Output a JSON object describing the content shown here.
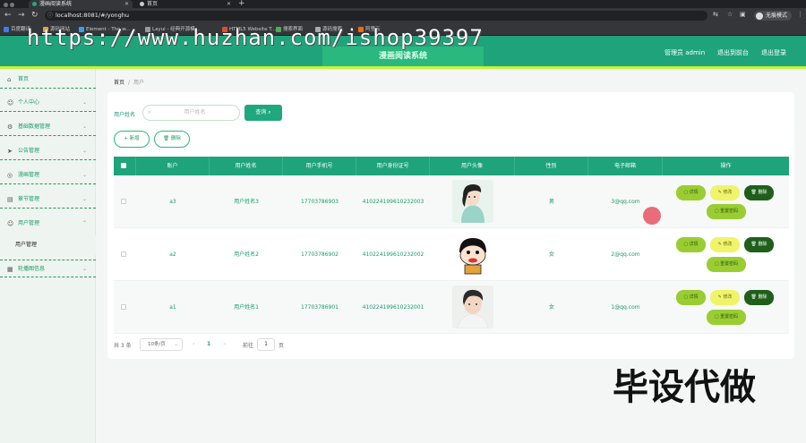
{
  "browser": {
    "tabs": [
      {
        "title": "漫画阅读系统",
        "active": true
      },
      {
        "title": "首页",
        "active": false
      }
    ],
    "url": "localhost:8081/#/yonghu",
    "profile_label": "无痕模式",
    "bookmarks": [
      "百度翻译",
      "源码网站",
      "Element - The w...",
      "Layui - 经典开源模...",
      "HTML5 Website T...",
      "搜索界面",
      "源码搜索",
      "阿里云"
    ]
  },
  "watermark_text": "https://www.huzhan.com/ishop39397",
  "header": {
    "title": "漫画阅读系统",
    "admin_label": "管理员 admin",
    "back_label": "退出到前台",
    "logout_label": "退出登录"
  },
  "sidebar": {
    "items": [
      {
        "label": "首页",
        "icon": "home-icon"
      },
      {
        "label": "个人中心",
        "icon": "user-icon"
      },
      {
        "label": "基础数据管理",
        "icon": "settings-icon"
      },
      {
        "label": "公告管理",
        "icon": "send-icon"
      },
      {
        "label": "漫画管理",
        "icon": "compass-icon"
      },
      {
        "label": "章节管理",
        "icon": "folder-icon"
      },
      {
        "label": "用户管理",
        "icon": "user-icon"
      },
      {
        "label": "轮播图信息",
        "icon": "image-icon"
      }
    ],
    "sub_active": "用户管理"
  },
  "breadcrumb": {
    "home": "首页",
    "sep": "/",
    "current": "用户"
  },
  "search": {
    "label": "用户姓名",
    "placeholder": "用户姓名",
    "button": "查询"
  },
  "actions": {
    "add": "新增",
    "delete": "删除"
  },
  "table": {
    "headers": [
      "账户",
      "用户姓名",
      "用户手机号",
      "用户身份证号",
      "用户头像",
      "性别",
      "电子邮箱",
      "操作"
    ],
    "rows": [
      {
        "account": "a3",
        "name": "用户姓名3",
        "phone": "17703786903",
        "idcard": "410224199610232003",
        "gender": "男",
        "email": "3@qq.com",
        "avatar": "photo-girl"
      },
      {
        "account": "a2",
        "name": "用户姓名2",
        "phone": "17703786902",
        "idcard": "410224199610232002",
        "gender": "女",
        "email": "2@qq.com",
        "avatar": "cartoon-boy"
      },
      {
        "account": "a1",
        "name": "用户姓名1",
        "phone": "17703786901",
        "idcard": "410224199610232001",
        "gender": "女",
        "email": "1@qq.com",
        "avatar": "photo-boy"
      }
    ],
    "row_actions": {
      "view": "详情",
      "edit": "修改",
      "delete": "删除",
      "reset": "重置密码"
    }
  },
  "pagination": {
    "total": "共 3 条",
    "page_size": "10条/页",
    "current": "1",
    "goto_label": "前往",
    "goto_value": "1",
    "page_suffix": "页"
  },
  "stamp_text": "毕设代做",
  "colors": {
    "primary": "#1fa37a",
    "accent_line": "#c3f23a",
    "view_btn": "#9acd32",
    "edit_btn": "#f0f46a",
    "delete_btn": "#1f5f1a"
  }
}
